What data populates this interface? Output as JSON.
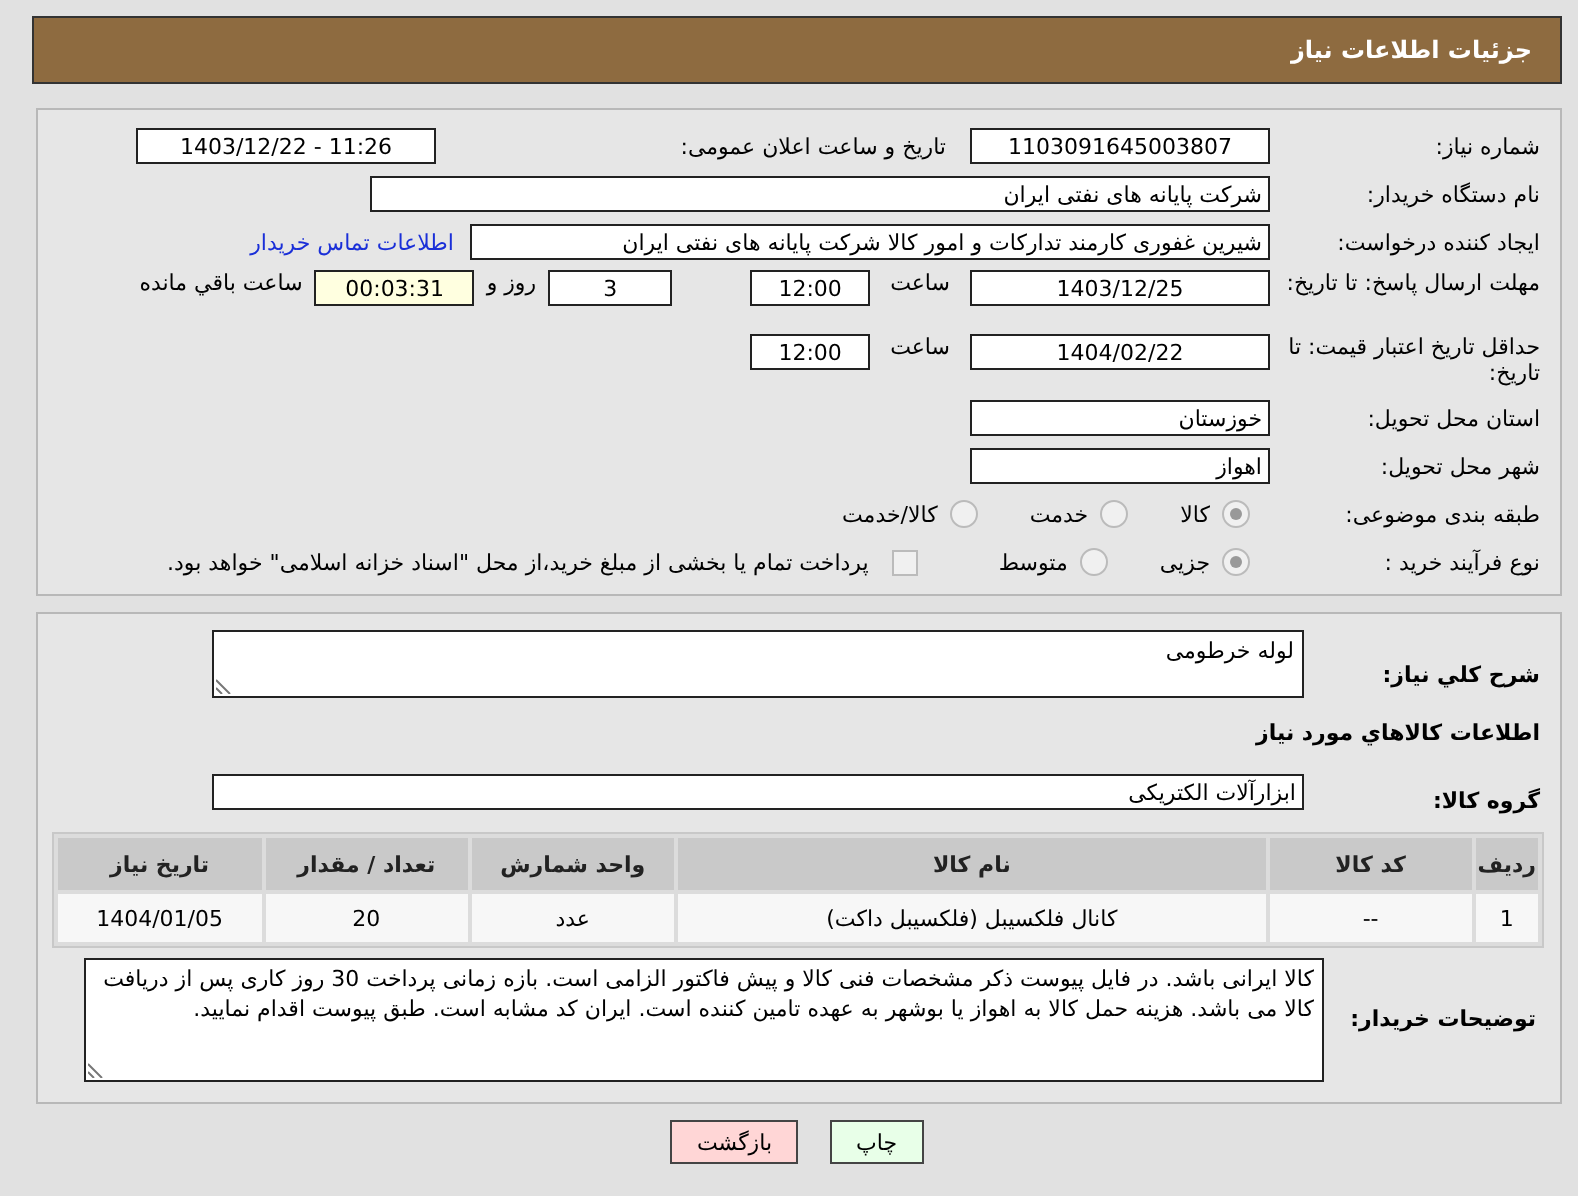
{
  "header": {
    "title": "جزئیات اطلاعات نیاز"
  },
  "need_number": {
    "label": "شماره نیاز:",
    "value": "1103091645003807"
  },
  "announce": {
    "label": "تاریخ و ساعت اعلان عمومی:",
    "value": "1403/12/22 - 11:26"
  },
  "buyer_org": {
    "label": "نام دستگاه خریدار:",
    "value": "شرکت پایانه های نفتی ایران"
  },
  "requester": {
    "label": "ایجاد کننده درخواست:",
    "value": "شیرین غفوری کارمند تدارکات و امور کالا شرکت پایانه های نفتی ایران",
    "link": "اطلاعات تماس خریدار"
  },
  "reply_deadline": {
    "label": "مهلت ارسال پاسخ: تا تاریخ:",
    "date": "1403/12/25",
    "time_label": "ساعت",
    "time": "12:00",
    "days": "3",
    "days_label": "روز و",
    "remaining": "00:03:31",
    "remaining_label": "ساعت باقي مانده"
  },
  "price_validity": {
    "label": "حداقل تاریخ اعتبار قیمت: تا تاریخ:",
    "date": "1404/02/22",
    "time_label": "ساعت",
    "time": "12:00"
  },
  "province": {
    "label": "استان محل تحویل:",
    "value": "خوزستان"
  },
  "city": {
    "label": "شهر محل تحویل:",
    "value": "اهواز"
  },
  "category": {
    "label": "طبقه بندی موضوعی:",
    "options": [
      {
        "label": "کالا",
        "selected": true
      },
      {
        "label": "خدمت",
        "selected": false
      },
      {
        "label": "کالا/خدمت",
        "selected": false
      }
    ]
  },
  "process": {
    "label": "نوع فرآیند خرید :",
    "options": [
      {
        "label": "جزیی",
        "selected": true
      },
      {
        "label": "متوسط",
        "selected": false
      }
    ],
    "treasury": {
      "label": "پرداخت تمام یا بخشی از مبلغ خرید،از محل \"اسناد خزانه اسلامی\" خواهد بود.",
      "checked": false
    }
  },
  "description": {
    "label": "شرح کلي نیاز:",
    "value": "لوله خرطومی"
  },
  "items_title": "اطلاعات کالاهاي مورد نیاز",
  "goods_group": {
    "label": "گروه کالا:",
    "value": "ابزارآلات الکتریکی"
  },
  "table": {
    "columns": [
      "ردیف",
      "کد کالا",
      "نام کالا",
      "واحد شمارش",
      "تعداد / مقدار",
      "تاریخ نیاز"
    ],
    "rows": [
      [
        "1",
        "--",
        "کانال فلکسیبل (فلکسیبل داکت)",
        "عدد",
        "20",
        "1404/01/05"
      ]
    ]
  },
  "buyer_notes": {
    "label": "توضیحات خریدار:",
    "value": "کالا ایرانی باشد. در فایل پیوست ذکر مشخصات فنی کالا و پیش فاکتور الزامی است. بازه زمانی پرداخت 30 روز کاری پس از دریافت کالا می باشد. هزینه حمل کالا به اهواز یا بوشهر به عهده تامین کننده است. ایران کد مشابه است. طبق پیوست اقدام نمایید."
  },
  "buttons": [
    {
      "label": "چاپ",
      "kind": "print"
    },
    {
      "label": "بازگشت",
      "kind": "back"
    }
  ]
}
